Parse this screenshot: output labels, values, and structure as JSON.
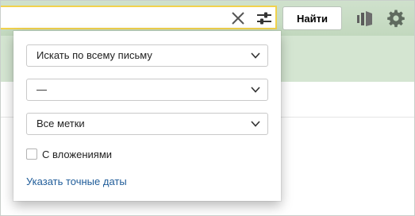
{
  "search": {
    "value": "",
    "find_label": "Найти"
  },
  "filters": {
    "scope_select": "Искать по всему письму",
    "folder_select": "—",
    "labels_select": "Все метки",
    "attachments_checkbox_label": "С вложениями",
    "attachments_checked": false,
    "exact_dates_link": "Указать точные даты"
  },
  "colors": {
    "search_border": "#f1d24d",
    "header_green": "#c2d8be",
    "link": "#1f5c99"
  },
  "icons": {
    "clear": "close-icon",
    "filter": "sliders-icon",
    "logo": "mail-logo-icon",
    "settings": "gear-icon",
    "select_arrow": "chevron-down-icon"
  }
}
